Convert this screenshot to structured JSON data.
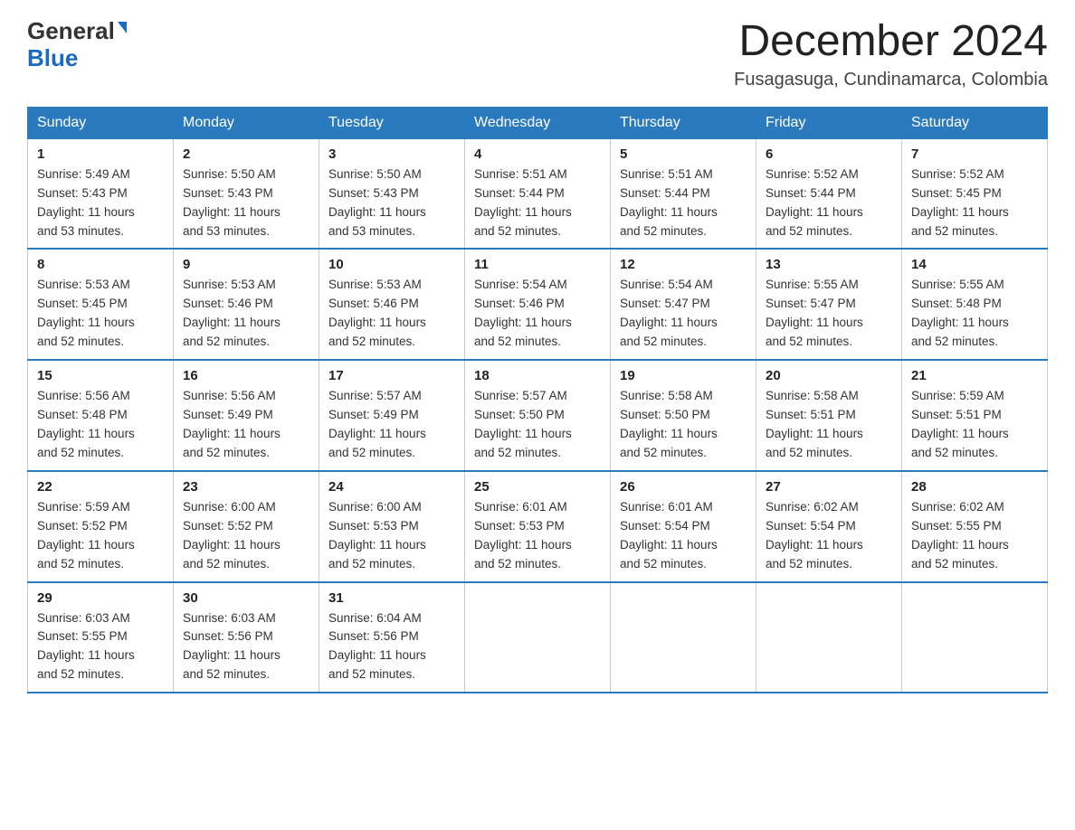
{
  "header": {
    "logo_general": "General",
    "logo_blue": "Blue",
    "month_year": "December 2024",
    "location": "Fusagasuga, Cundinamarca, Colombia"
  },
  "weekdays": [
    "Sunday",
    "Monday",
    "Tuesday",
    "Wednesday",
    "Thursday",
    "Friday",
    "Saturday"
  ],
  "weeks": [
    [
      {
        "day": "1",
        "sunrise": "5:49 AM",
        "sunset": "5:43 PM",
        "daylight": "11 hours and 53 minutes."
      },
      {
        "day": "2",
        "sunrise": "5:50 AM",
        "sunset": "5:43 PM",
        "daylight": "11 hours and 53 minutes."
      },
      {
        "day": "3",
        "sunrise": "5:50 AM",
        "sunset": "5:43 PM",
        "daylight": "11 hours and 53 minutes."
      },
      {
        "day": "4",
        "sunrise": "5:51 AM",
        "sunset": "5:44 PM",
        "daylight": "11 hours and 52 minutes."
      },
      {
        "day": "5",
        "sunrise": "5:51 AM",
        "sunset": "5:44 PM",
        "daylight": "11 hours and 52 minutes."
      },
      {
        "day": "6",
        "sunrise": "5:52 AM",
        "sunset": "5:44 PM",
        "daylight": "11 hours and 52 minutes."
      },
      {
        "day": "7",
        "sunrise": "5:52 AM",
        "sunset": "5:45 PM",
        "daylight": "11 hours and 52 minutes."
      }
    ],
    [
      {
        "day": "8",
        "sunrise": "5:53 AM",
        "sunset": "5:45 PM",
        "daylight": "11 hours and 52 minutes."
      },
      {
        "day": "9",
        "sunrise": "5:53 AM",
        "sunset": "5:46 PM",
        "daylight": "11 hours and 52 minutes."
      },
      {
        "day": "10",
        "sunrise": "5:53 AM",
        "sunset": "5:46 PM",
        "daylight": "11 hours and 52 minutes."
      },
      {
        "day": "11",
        "sunrise": "5:54 AM",
        "sunset": "5:46 PM",
        "daylight": "11 hours and 52 minutes."
      },
      {
        "day": "12",
        "sunrise": "5:54 AM",
        "sunset": "5:47 PM",
        "daylight": "11 hours and 52 minutes."
      },
      {
        "day": "13",
        "sunrise": "5:55 AM",
        "sunset": "5:47 PM",
        "daylight": "11 hours and 52 minutes."
      },
      {
        "day": "14",
        "sunrise": "5:55 AM",
        "sunset": "5:48 PM",
        "daylight": "11 hours and 52 minutes."
      }
    ],
    [
      {
        "day": "15",
        "sunrise": "5:56 AM",
        "sunset": "5:48 PM",
        "daylight": "11 hours and 52 minutes."
      },
      {
        "day": "16",
        "sunrise": "5:56 AM",
        "sunset": "5:49 PM",
        "daylight": "11 hours and 52 minutes."
      },
      {
        "day": "17",
        "sunrise": "5:57 AM",
        "sunset": "5:49 PM",
        "daylight": "11 hours and 52 minutes."
      },
      {
        "day": "18",
        "sunrise": "5:57 AM",
        "sunset": "5:50 PM",
        "daylight": "11 hours and 52 minutes."
      },
      {
        "day": "19",
        "sunrise": "5:58 AM",
        "sunset": "5:50 PM",
        "daylight": "11 hours and 52 minutes."
      },
      {
        "day": "20",
        "sunrise": "5:58 AM",
        "sunset": "5:51 PM",
        "daylight": "11 hours and 52 minutes."
      },
      {
        "day": "21",
        "sunrise": "5:59 AM",
        "sunset": "5:51 PM",
        "daylight": "11 hours and 52 minutes."
      }
    ],
    [
      {
        "day": "22",
        "sunrise": "5:59 AM",
        "sunset": "5:52 PM",
        "daylight": "11 hours and 52 minutes."
      },
      {
        "day": "23",
        "sunrise": "6:00 AM",
        "sunset": "5:52 PM",
        "daylight": "11 hours and 52 minutes."
      },
      {
        "day": "24",
        "sunrise": "6:00 AM",
        "sunset": "5:53 PM",
        "daylight": "11 hours and 52 minutes."
      },
      {
        "day": "25",
        "sunrise": "6:01 AM",
        "sunset": "5:53 PM",
        "daylight": "11 hours and 52 minutes."
      },
      {
        "day": "26",
        "sunrise": "6:01 AM",
        "sunset": "5:54 PM",
        "daylight": "11 hours and 52 minutes."
      },
      {
        "day": "27",
        "sunrise": "6:02 AM",
        "sunset": "5:54 PM",
        "daylight": "11 hours and 52 minutes."
      },
      {
        "day": "28",
        "sunrise": "6:02 AM",
        "sunset": "5:55 PM",
        "daylight": "11 hours and 52 minutes."
      }
    ],
    [
      {
        "day": "29",
        "sunrise": "6:03 AM",
        "sunset": "5:55 PM",
        "daylight": "11 hours and 52 minutes."
      },
      {
        "day": "30",
        "sunrise": "6:03 AM",
        "sunset": "5:56 PM",
        "daylight": "11 hours and 52 minutes."
      },
      {
        "day": "31",
        "sunrise": "6:04 AM",
        "sunset": "5:56 PM",
        "daylight": "11 hours and 52 minutes."
      },
      null,
      null,
      null,
      null
    ]
  ],
  "labels": {
    "sunrise": "Sunrise:",
    "sunset": "Sunset:",
    "daylight": "Daylight:"
  }
}
